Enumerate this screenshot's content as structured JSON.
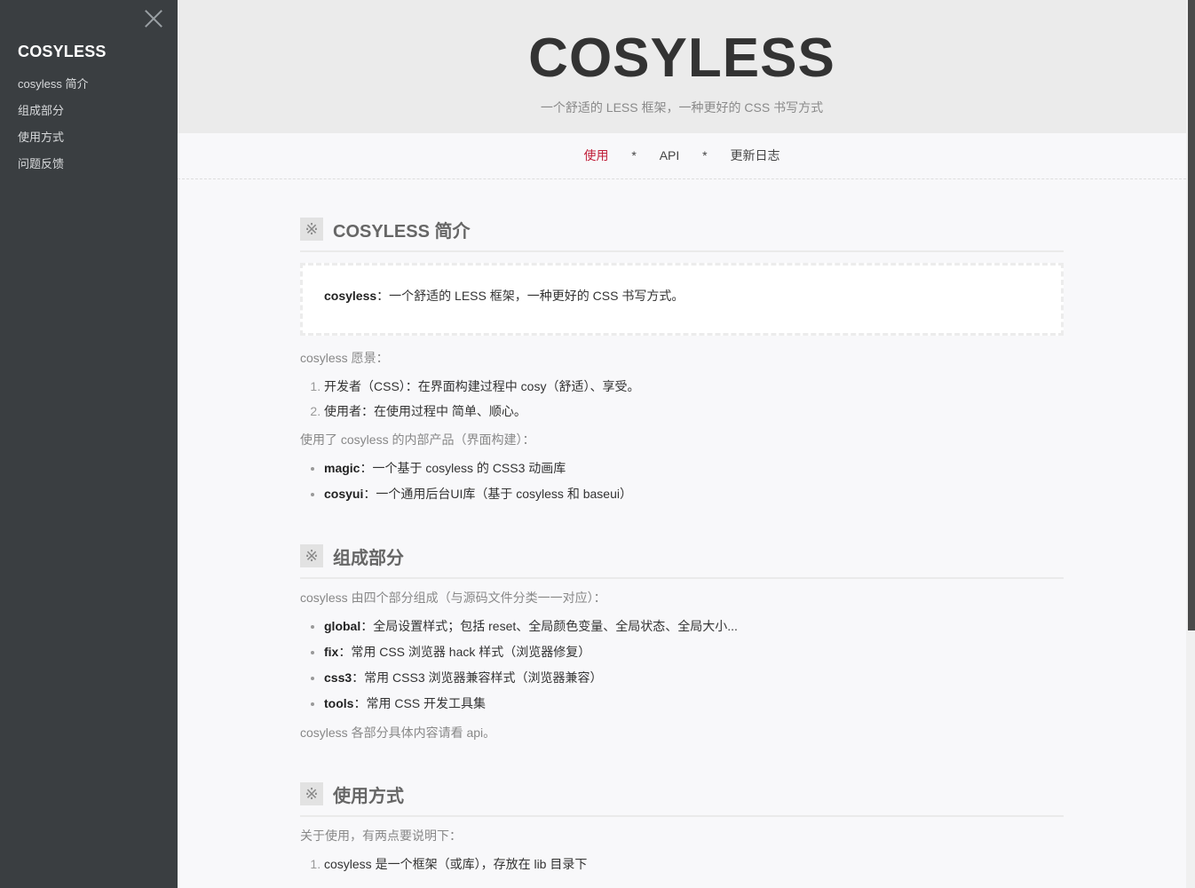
{
  "sidebar": {
    "title": "COSYLESS",
    "items": [
      {
        "label": "cosyless 简介"
      },
      {
        "label": "组成部分"
      },
      {
        "label": "使用方式"
      },
      {
        "label": "问题反馈"
      }
    ]
  },
  "hero": {
    "title": "COSYLESS",
    "subtitle": "一个舒适的 LESS 框架，一种更好的 CSS 书写方式"
  },
  "topnav": {
    "items": [
      {
        "label": "使用"
      },
      {
        "label": "API"
      },
      {
        "label": "更新日志"
      }
    ],
    "separator": "*"
  },
  "sections": {
    "intro": {
      "icon": "※",
      "title": "COSYLESS 简介",
      "quote_bold": "cosyless",
      "quote_text": "：一个舒适的 LESS 框架，一种更好的 CSS 书写方式。",
      "vision_label": "cosyless 愿景：",
      "vision": [
        "开发者（CSS）：在界面构建过程中 cosy（舒适）、享受。",
        "使用者：在使用过程中 简单、顺心。"
      ],
      "products_label": "使用了 cosyless 的内部产品（界面构建）：",
      "products": [
        {
          "name": "magic",
          "desc": "：一个基于 cosyless 的 CSS3 动画库"
        },
        {
          "name": "cosyui",
          "desc": "：一个通用后台UI库（基于 cosyless 和 baseui）"
        }
      ]
    },
    "parts": {
      "icon": "※",
      "title": "组成部分",
      "intro": "cosyless 由四个部分组成（与源码文件分类一一对应）：",
      "items": [
        {
          "name": "global",
          "desc": "：全局设置样式；包括 reset、全局颜色变量、全局状态、全局大小..."
        },
        {
          "name": "fix",
          "desc": "：常用 CSS 浏览器 hack 样式（浏览器修复）"
        },
        {
          "name": "css3",
          "desc": "：常用 CSS3 浏览器兼容样式（浏览器兼容）"
        },
        {
          "name": "tools",
          "desc": "：常用 CSS 开发工具集"
        }
      ],
      "outro": "cosyless 各部分具体内容请看 api。"
    },
    "usage": {
      "icon": "※",
      "title": "使用方式",
      "intro": "关于使用，有两点要说明下：",
      "items": [
        "cosyless 是一个框架（或库），存放在 lib 目录下"
      ]
    }
  }
}
